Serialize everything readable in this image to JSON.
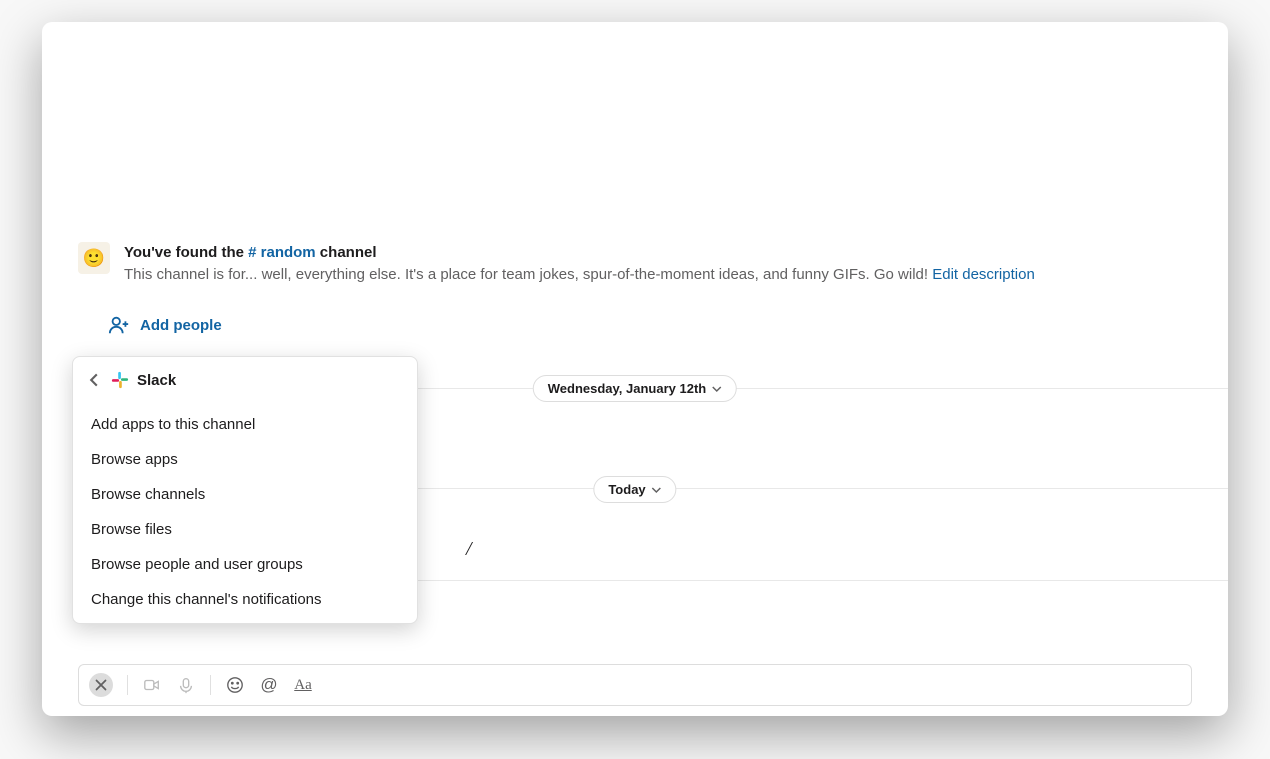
{
  "intro": {
    "emoji": "🙂",
    "title_prefix": "You've found the ",
    "channel_hash": "# random",
    "title_suffix": " channel",
    "description": "This channel is for... well, everything else. It's a place for team jokes, spur-of-the-moment ideas, and funny GIFs. Go wild! ",
    "edit_link": "Edit description"
  },
  "add_people_label": "Add people",
  "dates": {
    "d1": "Wednesday, January 12th",
    "d2": "Today"
  },
  "menu": {
    "title": "Slack",
    "items": [
      "Add apps to this channel",
      "Browse apps",
      "Browse channels",
      "Browse files",
      "Browse people and user groups",
      "Change this channel's notifications"
    ]
  },
  "composer": {
    "at": "@",
    "aa": "Aa"
  },
  "stray_text": "/"
}
